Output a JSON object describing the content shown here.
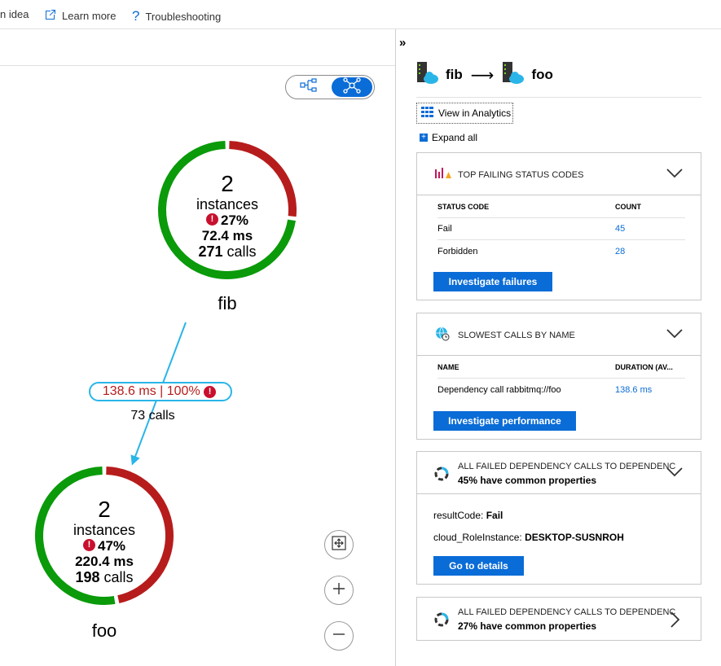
{
  "toolbar": {
    "idea_label": "n idea",
    "learn_more_label": "Learn more",
    "troubleshooting_label": "Troubleshooting"
  },
  "map": {
    "nodes": [
      {
        "name": "fib",
        "instances_count": "2",
        "instances_label": "instances",
        "failure_pct": "27%",
        "duration": "72.4 ms",
        "calls_count": "271",
        "calls_label": "calls",
        "fail_fraction": 0.27
      },
      {
        "name": "foo",
        "instances_count": "2",
        "instances_label": "instances",
        "failure_pct": "47%",
        "duration": "220.4 ms",
        "calls_count": "198",
        "calls_label": "calls",
        "fail_fraction": 0.47
      }
    ],
    "edge": {
      "duration": "138.6 ms",
      "separator": "|",
      "failure_pct": "100%",
      "calls": "73 calls"
    },
    "colors": {
      "success": "#0a9a0a",
      "failure": "#b71c1c",
      "edge": "#2ab5e8"
    },
    "icons": {
      "hierarchy": "hierarchy-view-icon",
      "network": "network-view-icon",
      "fit": "fit-to-screen-icon",
      "zoom_in": "zoom-in-icon",
      "zoom_out": "zoom-out-icon"
    }
  },
  "panel": {
    "collapse_label": "»",
    "route": {
      "source": "fib",
      "arrow": "⟶",
      "target": "foo"
    },
    "analytics_label": "View in Analytics",
    "expand_all_label": "Expand all",
    "cards": {
      "status_codes": {
        "title": "TOP FAILING STATUS CODES",
        "columns": [
          "STATUS CODE",
          "COUNT"
        ],
        "rows": [
          [
            "Fail",
            "45"
          ],
          [
            "Forbidden",
            "28"
          ]
        ],
        "button": "Investigate failures"
      },
      "slowest": {
        "title": "SLOWEST CALLS BY NAME",
        "columns": [
          "NAME",
          "DURATION (AV..."
        ],
        "rows": [
          [
            "Dependency call rabbitmq://foo",
            "138.6 ms"
          ]
        ],
        "button": "Investigate performance"
      },
      "failed1": {
        "title": "ALL FAILED DEPENDENCY CALLS TO DEPENDENC",
        "subtitle": "45% have common properties",
        "props": [
          {
            "key": "resultCode:",
            "value": "Fail"
          },
          {
            "key": "cloud_RoleInstance:",
            "value": "DESKTOP-SUSNROH"
          }
        ],
        "button": "Go to details"
      },
      "failed2": {
        "title": "ALL FAILED DEPENDENCY CALLS TO DEPENDENC",
        "subtitle": "27% have common properties"
      }
    }
  }
}
